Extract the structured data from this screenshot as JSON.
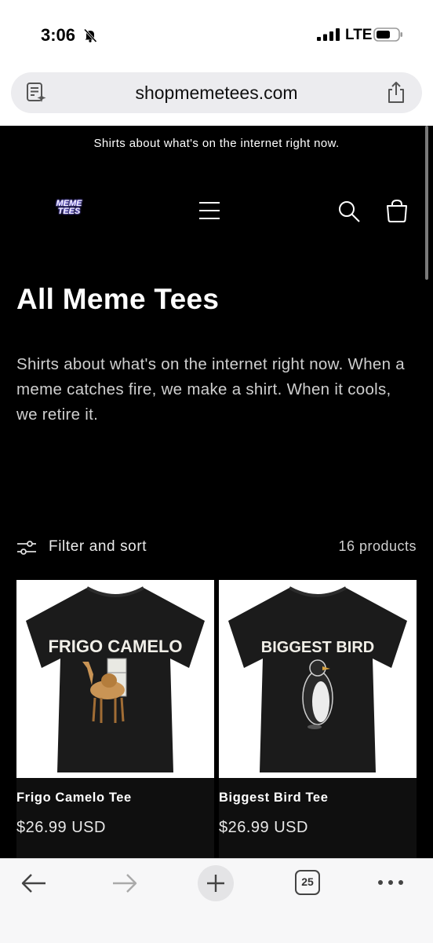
{
  "status_bar": {
    "time": "3:06",
    "network": "LTE"
  },
  "browser": {
    "url": "shopmemetees.com"
  },
  "announcement": "Shirts about what's on the internet right now.",
  "header": {
    "logo_line1": "MEME",
    "logo_line2": "TEES"
  },
  "collection": {
    "title": "All Meme Tees",
    "description": "Shirts about what's on the internet right now. When a meme catches fire, we make a shirt. When it cools, we retire it."
  },
  "filter": {
    "label": "Filter and sort",
    "count": "16 products"
  },
  "products": [
    {
      "name": "Frigo Camelo Tee",
      "price": "$26.99 USD",
      "shirt_text": "FRIGO CAMELO"
    },
    {
      "name": "Biggest Bird Tee",
      "price": "$26.99 USD",
      "shirt_text": "BIGGEST BIRD"
    }
  ],
  "toolbar": {
    "tab_count": "25"
  },
  "colors": {
    "page_bg": "#000000",
    "text": "#ffffff",
    "logo_glow": "#7a6cff"
  }
}
